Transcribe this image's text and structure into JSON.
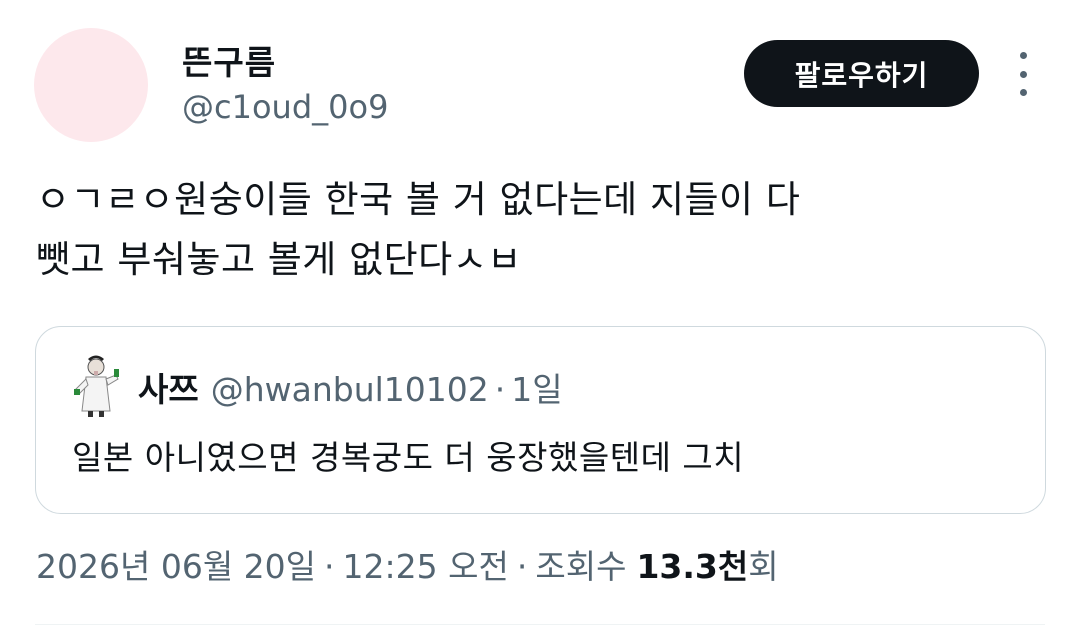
{
  "author": {
    "display_name": "뜬구름",
    "handle": "@c1oud_0o9",
    "avatar_color": "#fde8ec"
  },
  "actions": {
    "follow_label": "팔로우하기",
    "more_icon": "more-vertical-icon"
  },
  "tweet": {
    "lines": [
      "ㅇㄱㄹㅇ원숭이들 한국 볼 거 없다는데 지들이 다",
      "뺏고 부숴놓고 볼게 없단다ㅅㅂ"
    ]
  },
  "quote": {
    "display_name": "사쯔",
    "handle": "@hwanbul10102",
    "separator": "·",
    "time": "1일",
    "text": "일본 아니였으면 경복궁도 더 웅장했을텐데 그치"
  },
  "meta": {
    "date": "2026년 06월 20일",
    "separator": "·",
    "time": "12:25 오전",
    "views_label": "조회수",
    "views_count": "13.3천",
    "views_suffix": "회"
  },
  "colors": {
    "text_primary": "#0f1419",
    "text_secondary": "#536471",
    "border": "#cfd9de",
    "button_bg": "#0f1419"
  }
}
